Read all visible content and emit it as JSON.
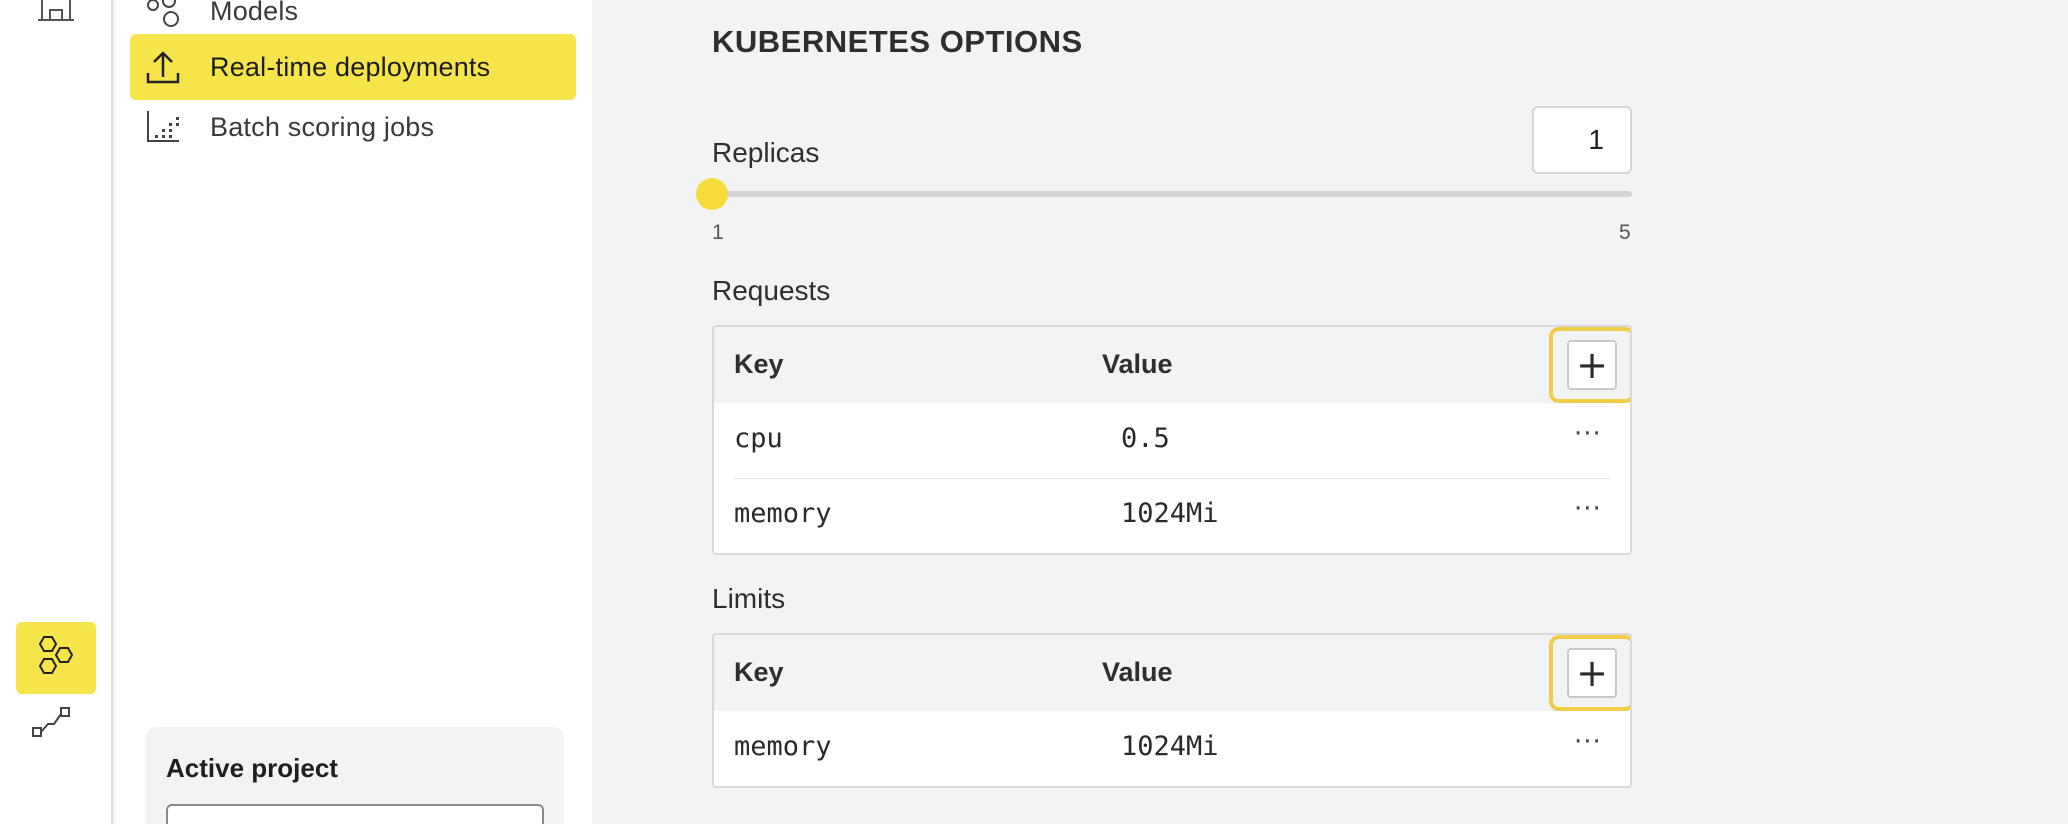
{
  "nav": {
    "items": [
      {
        "label": "Models",
        "icon": "models-icon"
      },
      {
        "label": "Real-time deployments",
        "icon": "upload-icon",
        "active": true
      },
      {
        "label": "Batch scoring jobs",
        "icon": "batch-chart-icon"
      }
    ]
  },
  "rail": {
    "top_icon": "building-icon",
    "apps_icon": "hexagons-icon",
    "pipeline_icon": "pipeline-icon",
    "accent_color": "#f7e44a"
  },
  "active_project": {
    "title": "Active project"
  },
  "kubernetes": {
    "title": "KUBERNETES OPTIONS",
    "replicas": {
      "label": "Replicas",
      "value": "1",
      "min": "1",
      "max": "5",
      "level_fraction": 0
    },
    "requests": {
      "label": "Requests",
      "header_key": "Key",
      "header_value": "Value",
      "add_label": "+",
      "rows": [
        {
          "key": "cpu",
          "value": "0.5",
          "more": "···"
        },
        {
          "key": "memory",
          "value": "1024Mi",
          "more": "···"
        }
      ]
    },
    "limits": {
      "label": "Limits",
      "header_key": "Key",
      "header_value": "Value",
      "add_label": "+",
      "rows": [
        {
          "key": "memory",
          "value": "1024Mi",
          "more": "···"
        }
      ]
    }
  }
}
